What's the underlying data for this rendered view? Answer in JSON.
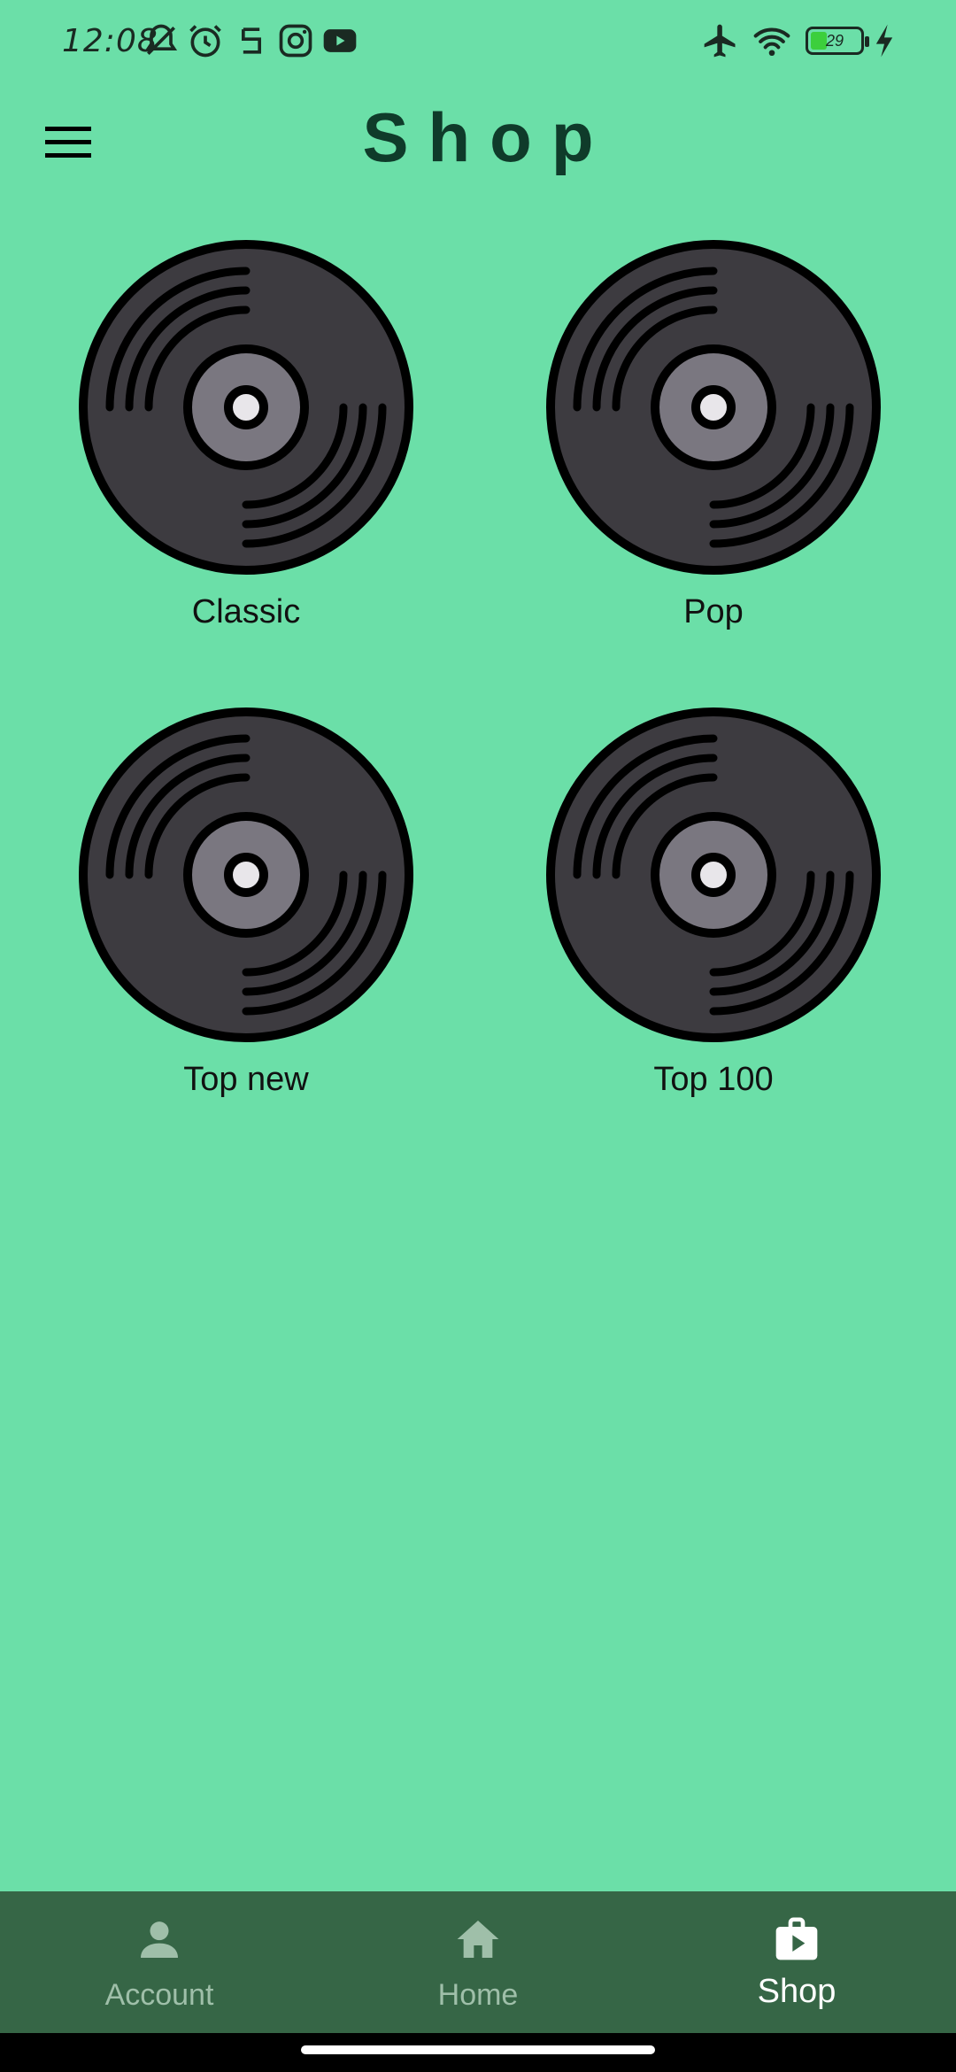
{
  "status_bar": {
    "time": "12:08",
    "battery_level": "29",
    "icons_left": [
      "bell-off-icon",
      "alarm-icon",
      "app-icon",
      "instagram-icon",
      "youtube-icon"
    ],
    "icons_right": [
      "airplane-mode-icon",
      "wifi-icon",
      "battery-icon",
      "charging-icon"
    ]
  },
  "app_bar": {
    "title": "Shop",
    "menu_icon": "hamburger-menu-icon"
  },
  "categories": [
    {
      "label": "Classic",
      "icon": "vinyl-record-icon"
    },
    {
      "label": "Pop",
      "icon": "vinyl-record-icon"
    },
    {
      "label": "Top new",
      "icon": "vinyl-record-icon"
    },
    {
      "label": "Top 100",
      "icon": "vinyl-record-icon"
    }
  ],
  "bottom_nav": {
    "items": [
      {
        "label": "Account",
        "icon": "person-icon",
        "active": false
      },
      {
        "label": "Home",
        "icon": "home-icon",
        "active": false
      },
      {
        "label": "Shop",
        "icon": "shop-bag-icon",
        "active": true
      }
    ]
  },
  "colors": {
    "background": "#6BDFA8",
    "title": "#0f3b2a",
    "bottom_nav": "#366646",
    "nav_inactive": "#9fbfa9",
    "nav_active": "#ffffff",
    "disc_body": "#3d3b40",
    "disc_label": "#7a7780"
  }
}
